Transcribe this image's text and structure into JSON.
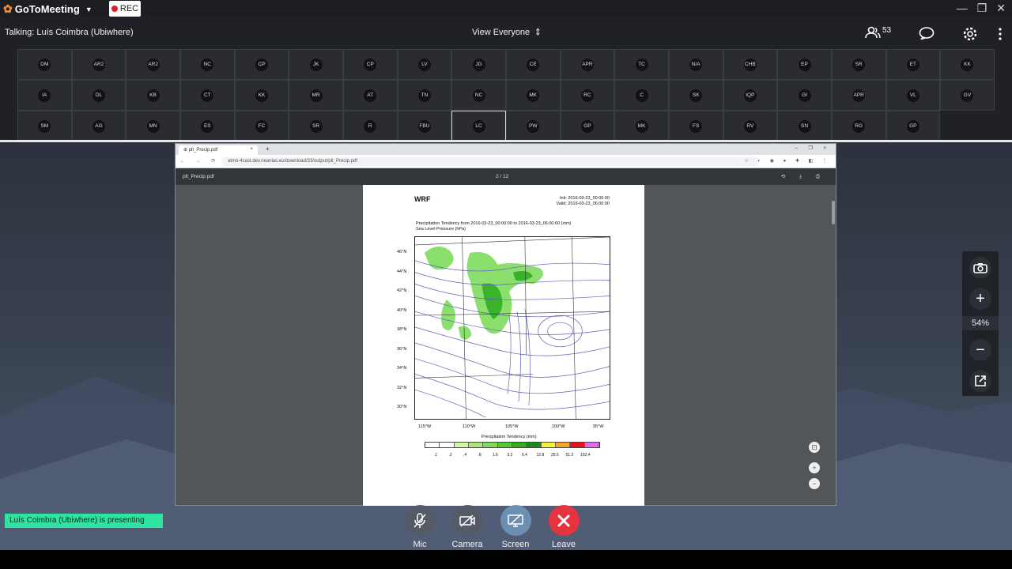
{
  "app": {
    "logo_text": "GoToMeeting",
    "rec_label": "REC"
  },
  "info": {
    "talking": "Talking: Luís Coimbra (Ubiwhere)",
    "view_label": "View Everyone",
    "participants_count": "53"
  },
  "participants": [
    [
      "DM",
      "AR2",
      "AR2",
      "NC",
      "CP",
      "JK",
      "CP",
      "LV",
      "JG",
      "CE",
      "APR",
      "TC",
      "N/A",
      "CHB",
      "EP",
      "SR",
      "ET",
      "KK"
    ],
    [
      "IA",
      "DL",
      "KB",
      "CT",
      "KK",
      "MR",
      "AT",
      "TN",
      "NC",
      "MK",
      "RC",
      "C",
      "SK",
      "IQP",
      "GI",
      "APR",
      "VL",
      "GV"
    ],
    [
      "SM",
      "AG",
      "MN",
      "ES",
      "FC",
      "SR",
      "R",
      "FBU",
      "LC",
      "PW",
      "GP",
      "MK",
      "FS",
      "RV",
      "SN",
      "RG",
      "GP"
    ]
  ],
  "browser": {
    "tab_title": "plt_Precip.pdf",
    "url": "atmo-4cast.dev.neanias.eu/download/33/output/plt_Precip.pdf",
    "pdf_name": "plt_Precip.pdf",
    "page_indicator": "2 / 12"
  },
  "pdf": {
    "model": "WRF",
    "init": "Init: 2016-03-23_00:00:00",
    "valid": "Valid: 2016-03-23_06:00:00",
    "caption1": "Precipitation Tendency from 2016-03-23_00:00:00 to 2016-03-23_06:00:00   (mm)",
    "caption2": "Sea Level Pressure   (hPa)",
    "latitudes": [
      "46°N",
      "44°N",
      "42°N",
      "40°N",
      "38°N",
      "36°N",
      "34°N",
      "32°N",
      "30°N"
    ],
    "longitudes": [
      "115°W",
      "110°W",
      "105°W",
      "100°W",
      "95°W"
    ],
    "colorbar_title": "Precipitation Tendency  (mm)",
    "colorbar_labels": [
      ".1",
      ".2",
      ".4",
      ".8",
      "1.6",
      "3.2",
      "6.4",
      "12.8",
      "25.6",
      "51.2",
      "102.4"
    ],
    "colorbar_colors": [
      "#ffffff",
      "#ffffff",
      "#d4f5a6",
      "#a8e67a",
      "#7ddd5a",
      "#53c933",
      "#2fae22",
      "#1b8a17",
      "#f6f23a",
      "#f2a32a",
      "#e8141c",
      "#e06ce6"
    ]
  },
  "side": {
    "zoom": "54%"
  },
  "status": {
    "presenting": "Luís Coimbra (Ubiwhere) is presenting"
  },
  "controls": {
    "mic": "Mic",
    "camera": "Camera",
    "screen": "Screen",
    "leave": "Leave"
  }
}
